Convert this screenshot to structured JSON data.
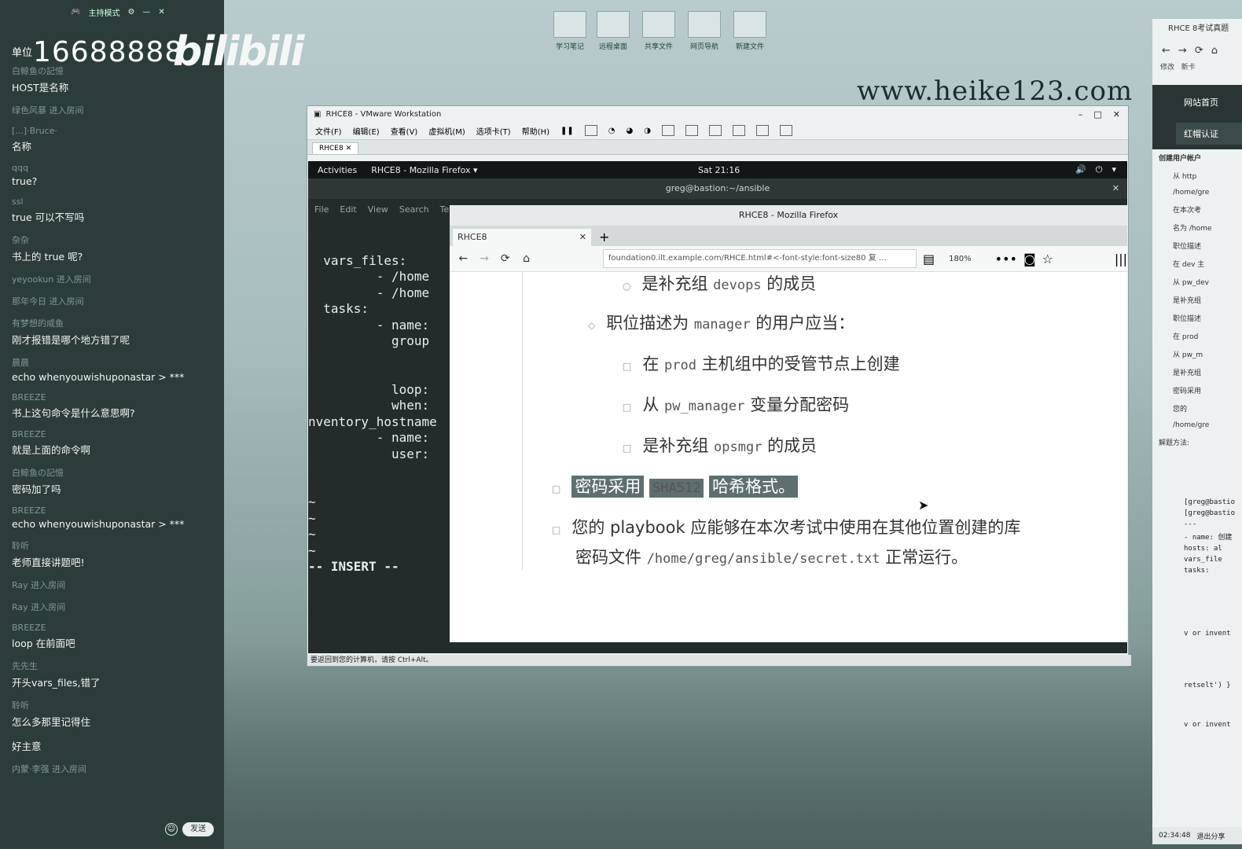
{
  "chat": {
    "top_label": "主持模式",
    "room_prefix": "单位",
    "room_id": "16688888",
    "logo": "bilibili",
    "messages": [
      {
        "user": "白鲸鱼の記憶",
        "text": "HOST是名称"
      },
      {
        "user": "绿色风暴 进入房间",
        "text": ""
      },
      {
        "user": "[...]·Bruce·",
        "text": "名称"
      },
      {
        "user": "qqq",
        "text": "true?"
      },
      {
        "user": "ssl",
        "text": "true 可以不写吗"
      },
      {
        "user": "杂杂",
        "text": "书上的 true 呢?"
      },
      {
        "user": "yeyookun 进入房间",
        "text": ""
      },
      {
        "user": "那年今日 进入房间",
        "text": ""
      },
      {
        "user": "有梦想的咸鱼",
        "text": "刚才报错是哪个地方错了呢"
      },
      {
        "user": "晨晨",
        "text": "echo whenyouwishuponastar > ***"
      },
      {
        "user": "BREEZE",
        "text": "书上这句命令是什么意思啊?"
      },
      {
        "user": "BREEZE",
        "text": "就是上面的命令啊"
      },
      {
        "user": "白鲸鱼の記憶",
        "text": "密码加了吗"
      },
      {
        "user": "BREEZE",
        "text": "echo whenyouwishuponastar > ***"
      },
      {
        "user": "聆听",
        "text": "老师直接讲题吧!"
      },
      {
        "user": "Ray 进入房间",
        "text": ""
      },
      {
        "user": "Ray 进入房间",
        "text": ""
      },
      {
        "user": "BREEZE",
        "text": "loop 在前面吧"
      },
      {
        "user": "先先生",
        "text": "开头vars_files,错了"
      },
      {
        "user": "聆听",
        "text": "怎么多那里记得住"
      },
      {
        "user": "",
        "text": "好主意"
      },
      {
        "user": "内蒙·李强 进入房间",
        "text": ""
      }
    ],
    "send_label": "发送"
  },
  "desktop": {
    "icons": [
      "学习笔记",
      "远程桌面",
      "共享文件",
      "网页导航",
      "新建文件"
    ],
    "watermark": "www.heike123.com"
  },
  "vmware": {
    "title": "RHCE8 - VMware Workstation",
    "menu": [
      "文件(F)",
      "编辑(E)",
      "查看(V)",
      "虚拟机(M)",
      "选项卡(T)",
      "帮助(H)"
    ],
    "tab": "RHCE8",
    "status": "要返回到您的计算机，请按 Ctrl+Alt。"
  },
  "guest": {
    "activities": "Activities",
    "app": "RHCE8 - Mozilla Firefox ▾",
    "clock": "Sat 21:16",
    "term_title": "greg@bastion:~/ansible",
    "term_menu": [
      "File",
      "Edit",
      "View",
      "Search",
      "Ter"
    ],
    "term_lines": [
      "",
      "  vars_files:",
      "         - /home",
      "         - /home",
      "  tasks:",
      "         - name:",
      "           group",
      "",
      "",
      "           loop:",
      "           when:",
      "nventory_hostname",
      "         - name:",
      "           user:",
      "",
      "",
      "~",
      "~",
      "~",
      "~",
      "-- INSERT --"
    ]
  },
  "firefox": {
    "title": "RHCE8 - Mozilla Firefox",
    "tab": "RHCE8",
    "url": "foundation0.ilt.example.com/RHCE.html#<-font-style:font-size80 复 …",
    "zoom": "180%",
    "lines": {
      "l1a": "是补充组 ",
      "l1b": "devops",
      "l1c": " 的成员",
      "l2a": "职位描述为 ",
      "l2b": "manager",
      "l2c": " 的用户应当：",
      "l3a": "在 ",
      "l3b": "prod",
      "l3c": " 主机组中的受管节点上创建",
      "l4a": "从 ",
      "l4b": "pw_manager",
      "l4c": " 变量分配密码",
      "l5a": "是补充组 ",
      "l5b": "opsmgr",
      "l5c": " 的成员",
      "l6a": "密码采用",
      "l6b": "SHA512",
      "l6c": "哈希格式。",
      "l7": "您的 playbook 应能够在本次考试中使用在其他位置创建的库",
      "l8a": "密码文件 ",
      "l8b": "/home/greg/ansible/secret.txt",
      "l8c": " 正常运行。"
    }
  },
  "right_panel": {
    "title": "RHCE 8考试真题",
    "sub": [
      "修改",
      "新卡"
    ],
    "home": "网站首页",
    "active": "红帽认证",
    "heading": "创建用户帐户",
    "items": [
      "从 http",
      "/home/gre",
      "在本次考",
      "名为 /home",
      "职位描述",
      "在 dev 主",
      "从 pw_dev",
      "是补充组",
      "职位描述",
      "在 prod",
      "从 pw_m",
      "是补充组",
      "密码采用",
      "您的",
      "/home/gre"
    ],
    "method": "解题方法:",
    "code": [
      "[greg@bastio",
      "[greg@bastio",
      "---",
      "- name: 创建",
      "  hosts: al",
      "  vars_file",
      "  tasks:",
      "v or invent",
      "retselt') }",
      "v or invent"
    ],
    "timer": "02:34:48",
    "exit": "退出分享"
  }
}
